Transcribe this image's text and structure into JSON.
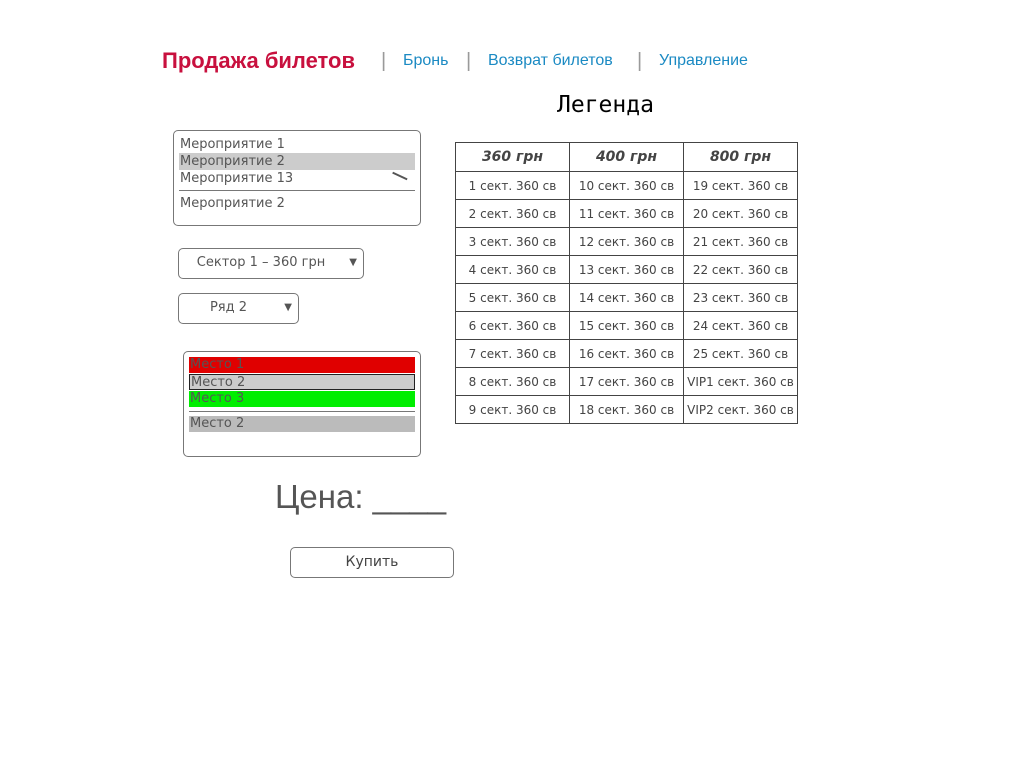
{
  "nav": {
    "brand": "Продажа билетов",
    "separator": "|",
    "links": [
      "Бронь",
      "Возврат билетов",
      "Управление"
    ]
  },
  "legend": {
    "title": "Легенда",
    "headers": [
      "360 грн",
      "400 грн",
      "800 грн"
    ],
    "rows": [
      [
        "1 сект. 360 св",
        "10 сект. 360 св",
        "19 сект. 360 св"
      ],
      [
        "2 сект. 360 св",
        "11 сект. 360 св",
        "20 сект. 360 св"
      ],
      [
        "3 сект. 360 св",
        "12 сект. 360 св",
        "21 сект. 360 св"
      ],
      [
        "4 сект. 360 св",
        "13 сект. 360 св",
        "22 сект. 360 св"
      ],
      [
        "5 сект. 360 св",
        "14 сект. 360 св",
        "23 сект. 360 св"
      ],
      [
        "6 сект. 360 св",
        "15 сект. 360 св",
        "24 сект. 360 св"
      ],
      [
        "7 сект. 360 св",
        "16 сект. 360 св",
        "25 сект. 360 св"
      ],
      [
        "8 сект. 360 св",
        "17 сект. 360 св",
        "VIP1 сект. 360 св"
      ],
      [
        "9 сект. 360 св",
        "18 сект. 360 св",
        "VIP2 сект. 360 св"
      ]
    ]
  },
  "events": {
    "items": [
      "Мероприятие 1",
      "Мероприятие 2",
      "Мероприятие 13"
    ],
    "selected_index": 1,
    "current": "Мероприятие 2",
    "selected_color": "#cccccc"
  },
  "sector_select": {
    "value": "Сектор 1 – 360 грн"
  },
  "row_select": {
    "value": "Ряд 2"
  },
  "seats": {
    "items": [
      {
        "label": "Место 1",
        "status": "taken",
        "color": "#e00000"
      },
      {
        "label": "Место 2",
        "status": "selected",
        "color": "#cccccc"
      },
      {
        "label": "Место 3",
        "status": "free",
        "color": "#00ee00"
      }
    ],
    "current": "Место 2",
    "current_color": "#bbbbbb"
  },
  "price": {
    "label": "Цена: ____"
  },
  "buy_button": {
    "label": "Купить"
  },
  "colors": {
    "brand": "#c8103e",
    "link": "#1b8ac3"
  }
}
